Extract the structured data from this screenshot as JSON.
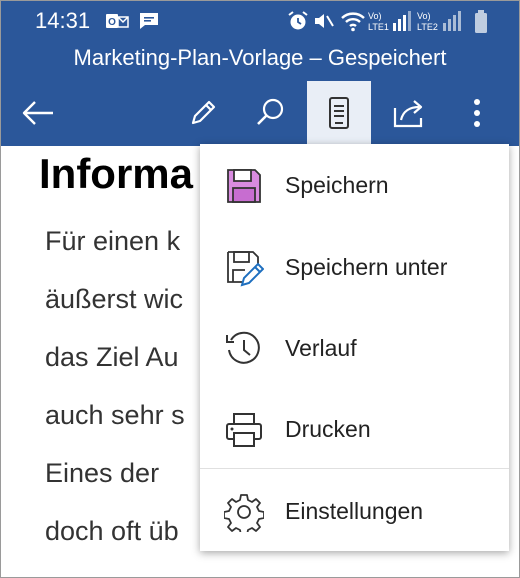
{
  "status": {
    "time": "14:31",
    "lte1": "Vo) LTE1",
    "lte2": "Vo) LTE2"
  },
  "title": "Marketing-Plan-Vorlage – Gespeichert",
  "document": {
    "heading": "Informa",
    "lines": [
      "Für einen k",
      "äußerst wic",
      "das Ziel Au",
      "auch sehr s",
      "Eines der",
      "doch oft üb"
    ]
  },
  "menu": {
    "items": [
      {
        "label": "Speichern",
        "icon": "save-icon"
      },
      {
        "label": "Speichern unter",
        "icon": "save-as-icon"
      },
      {
        "label": "Verlauf",
        "icon": "history-icon"
      },
      {
        "label": "Drucken",
        "icon": "print-icon"
      },
      {
        "label": "Einstellungen",
        "icon": "gear-icon"
      }
    ]
  },
  "colors": {
    "header": "#2b579a",
    "save_accent": "#c76dd0"
  }
}
